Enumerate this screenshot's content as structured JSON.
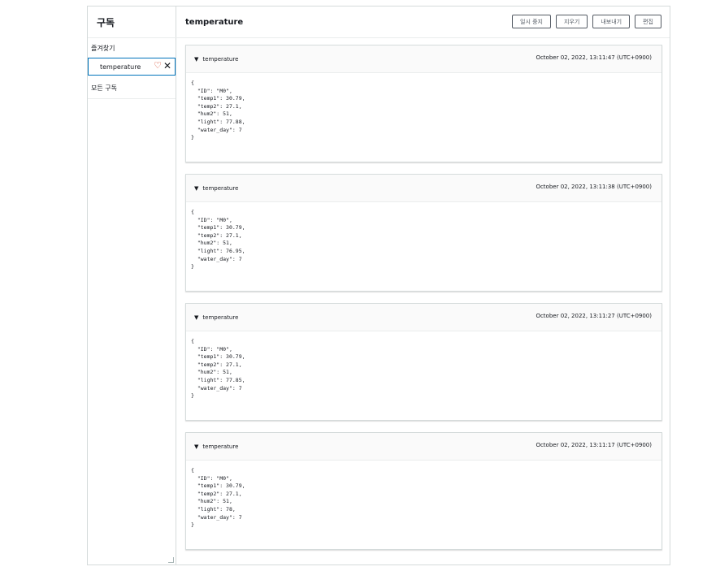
{
  "sidebar": {
    "title": "구독",
    "favorites_label": "즐겨찾기",
    "favorite_item": "temperature",
    "all_label": "모든 구독"
  },
  "main": {
    "title": "temperature",
    "buttons": [
      "일시 중지",
      "지우기",
      "내보내기",
      "편집"
    ]
  },
  "messages": [
    {
      "topic": "temperature",
      "timestamp": "October 02, 2022, 13:11:47 (UTC+0900)",
      "payload": "{\n  \"ID\": \"M0\",\n  \"temp1\": 30.79,\n  \"temp2\": 27.1,\n  \"hum2\": 51,\n  \"light\": 77.88,\n  \"water_day\": 7\n}"
    },
    {
      "topic": "temperature",
      "timestamp": "October 02, 2022, 13:11:38 (UTC+0900)",
      "payload": "{\n  \"ID\": \"M0\",\n  \"temp1\": 30.79,\n  \"temp2\": 27.1,\n  \"hum2\": 51,\n  \"light\": 76.95,\n  \"water_day\": 7\n}"
    },
    {
      "topic": "temperature",
      "timestamp": "October 02, 2022, 13:11:27 (UTC+0900)",
      "payload": "{\n  \"ID\": \"M0\",\n  \"temp1\": 30.79,\n  \"temp2\": 27.1,\n  \"hum2\": 51,\n  \"light\": 77.85,\n  \"water_day\": 7\n}"
    },
    {
      "topic": "temperature",
      "timestamp": "October 02, 2022, 13:11:17 (UTC+0900)",
      "payload": "{\n  \"ID\": \"M0\",\n  \"temp1\": 30.79,\n  \"temp2\": 27.1,\n  \"hum2\": 51,\n  \"light\": 78,\n  \"water_day\": 7\n}"
    }
  ],
  "icons": {
    "favorite": "heart-icon",
    "remove": "close-icon",
    "expand": "caret-down-icon"
  },
  "colors": {
    "accent": "#0073bb",
    "heart": "#d13212"
  }
}
